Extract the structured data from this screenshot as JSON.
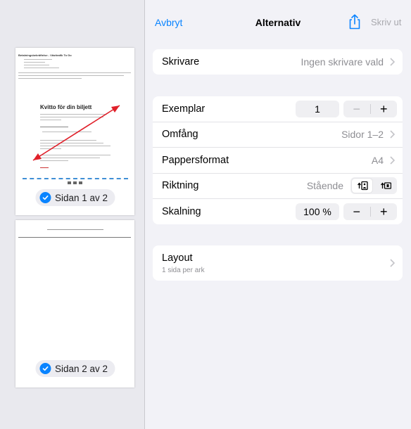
{
  "nav": {
    "cancel": "Avbryt",
    "title": "Alternativ",
    "print": "Skriv ut",
    "share_icon": "share-icon"
  },
  "printer": {
    "label": "Skrivare",
    "value": "Ingen skrivare vald"
  },
  "options": {
    "copies": {
      "label": "Exemplar",
      "value": "1"
    },
    "range": {
      "label": "Omfång",
      "value": "Sidor 1–2"
    },
    "paper": {
      "label": "Pappersformat",
      "value": "A4"
    },
    "orientation": {
      "label": "Riktning",
      "value": "Stående",
      "selected": "portrait"
    },
    "scale": {
      "label": "Skalning",
      "value": "100 %"
    }
  },
  "layout": {
    "label": "Layout",
    "sublabel": "1 sida per ark"
  },
  "stepper": {
    "minus": "−",
    "plus": "+"
  },
  "pages": [
    {
      "badge": "Sidan 1 av 2",
      "selected": true
    },
    {
      "badge": "Sidan 2 av 2",
      "selected": true
    }
  ],
  "preview": {
    "heading": "Betalningsbekräftelse - Västtrafik To Go",
    "receipt_title": "Kvitto för din biljett"
  },
  "colors": {
    "accent": "#0a84ff",
    "annotation": "#e0202a"
  }
}
